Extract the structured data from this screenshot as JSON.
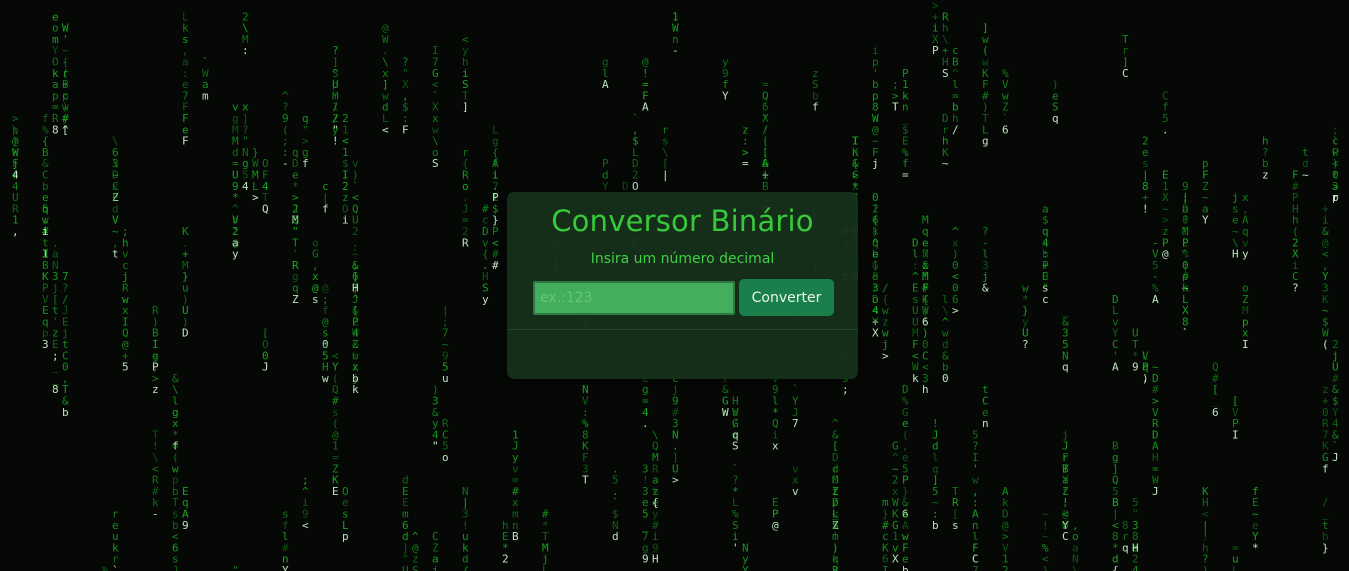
{
  "background": {
    "name": "matrix-rain",
    "color": "#050805",
    "glyph_color": "#19a821",
    "glyph_highlight": "#c8f0c8",
    "charset": "ABCDEFGHIJKLMNOPQRSTUVWXYZabcdefghijklmnopqrstuvwxyz0123456789!@#$%^&*()_+-=[]{}|;:'\",.<>/?\\~`"
  },
  "converter": {
    "title": "Conversor Binário",
    "subtitle": "Insira um número decimal",
    "input_placeholder": "ex.:123",
    "input_value": "",
    "button_label": "Converter",
    "result": "",
    "accent_color": "#37c93a",
    "button_color": "#1a7f4a"
  }
}
